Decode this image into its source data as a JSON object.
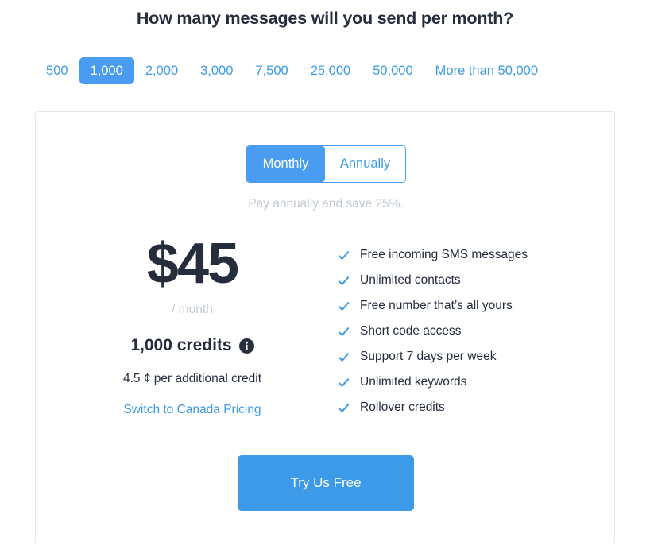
{
  "heading": "How many messages will you send per month?",
  "volume_tabs": {
    "selected": "1,000",
    "items": [
      {
        "label": "500"
      },
      {
        "label": "1,000"
      },
      {
        "label": "2,000"
      },
      {
        "label": "3,000"
      },
      {
        "label": "7,500"
      },
      {
        "label": "25,000"
      },
      {
        "label": "50,000"
      },
      {
        "label": "More than 50,000"
      }
    ]
  },
  "billing": {
    "monthly_label": "Monthly",
    "annually_label": "Annually",
    "selected": "Monthly",
    "annual_note": "Pay annually and save 25%."
  },
  "plan": {
    "price": "$45",
    "period": "/ month",
    "credits": "1,000 credits",
    "info_icon": "info-icon",
    "additional_credit_rate": "4.5 ¢ per additional credit",
    "region_link": "Switch to Canada Pricing"
  },
  "features": [
    {
      "label": "Free incoming SMS messages"
    },
    {
      "label": "Unlimited contacts"
    },
    {
      "label": "Free number that’s all yours"
    },
    {
      "label": "Short code access"
    },
    {
      "label": "Support 7 days per week"
    },
    {
      "label": "Unlimited keywords"
    },
    {
      "label": "Rollover credits"
    }
  ],
  "cta": {
    "label": "Try Us Free"
  },
  "colors": {
    "accent_blue": "#3d9ae8",
    "selected_blue": "#4a9cf0",
    "dark_navy": "#252d3d",
    "muted_gray": "#c3c9d1",
    "card_border": "#e3e7eb"
  }
}
